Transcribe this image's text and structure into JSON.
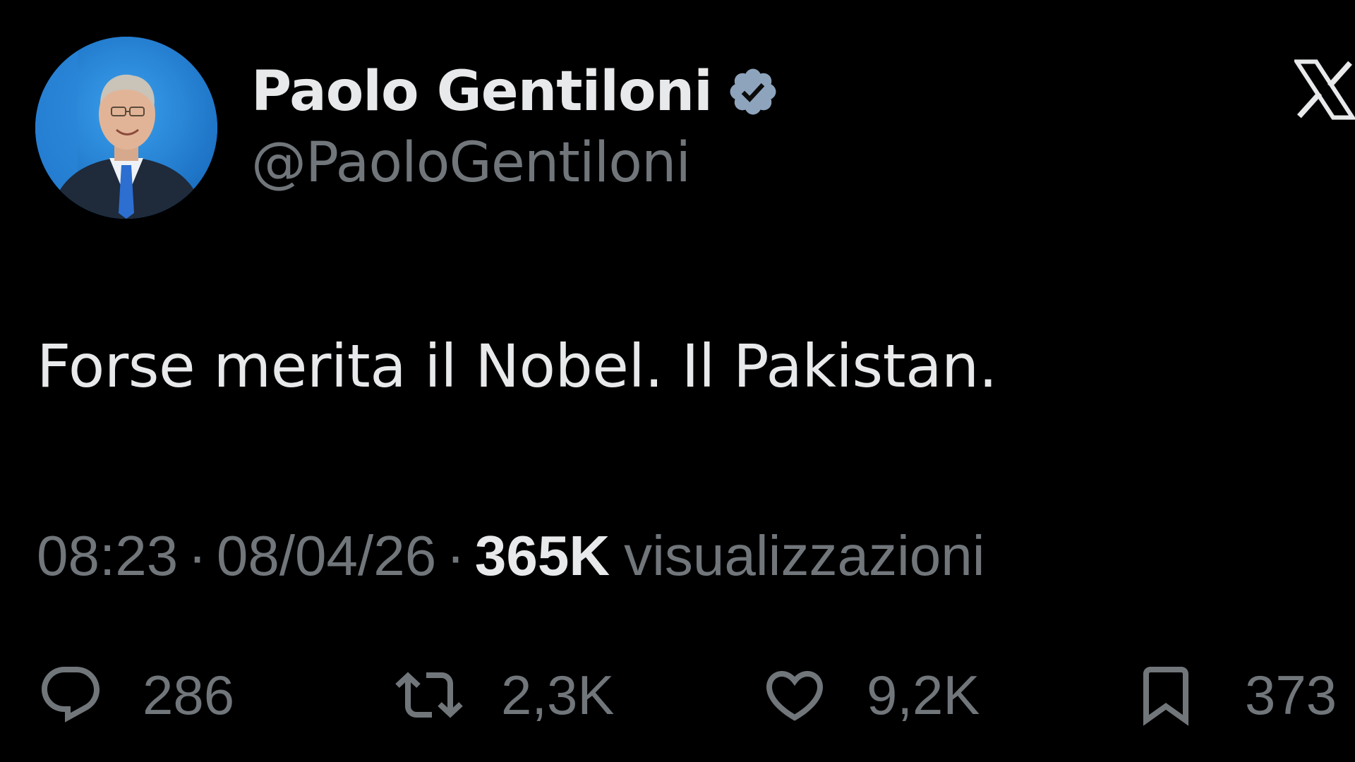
{
  "author": {
    "display_name": "Paolo Gentiloni",
    "handle": "@PaoloGentiloni",
    "verified": true,
    "avatar_icon": "profile-photo-icon",
    "badge_color": "#8ea4bd"
  },
  "brand": {
    "logo_icon": "x-logo-icon"
  },
  "tweet": {
    "text": "Forse merita il Nobel. Il Pakistan."
  },
  "meta": {
    "time": "08:23",
    "separator": "·",
    "date": "08/04/26",
    "views_count": "365K",
    "views_label": "visualizzazioni"
  },
  "actions": {
    "replies": {
      "icon": "reply-icon",
      "count": "286"
    },
    "reposts": {
      "icon": "repost-icon",
      "count": "2,3K"
    },
    "likes": {
      "icon": "heart-icon",
      "count": "9,2K"
    },
    "bookmarks": {
      "icon": "bookmark-icon",
      "count": "373"
    }
  },
  "colors": {
    "background": "#000000",
    "primary_text": "#e7e9ea",
    "secondary_text": "#71767b"
  }
}
